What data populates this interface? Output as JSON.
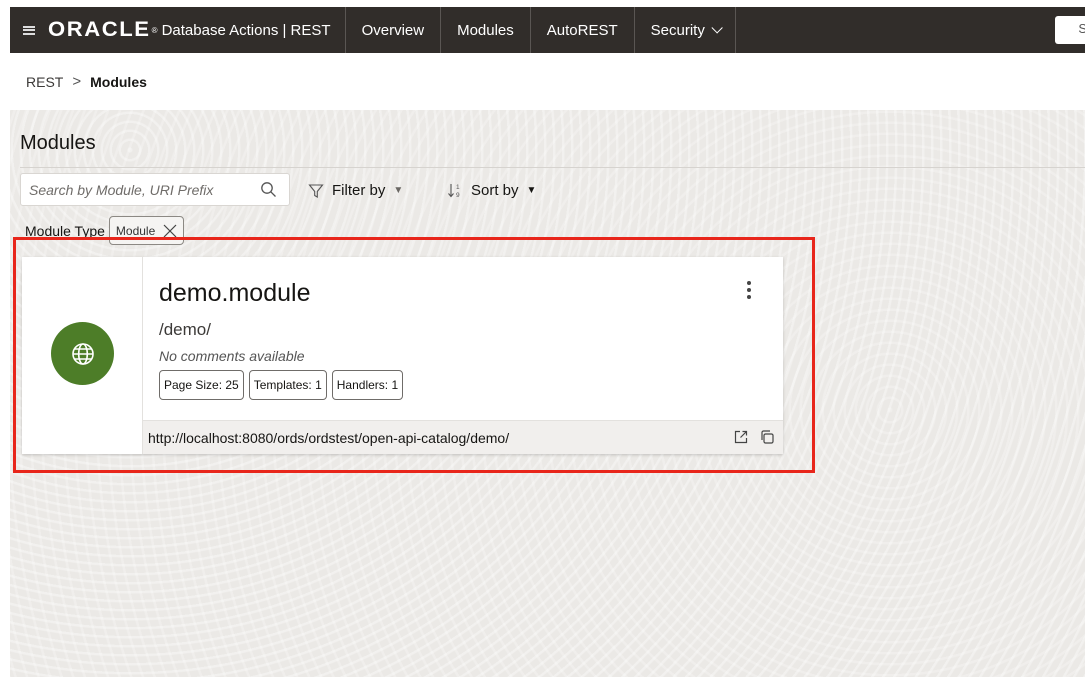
{
  "topbar": {
    "brand_logo": "ORACLE",
    "brand_mark": "®",
    "app_name": "Database Actions | REST",
    "tabs": [
      {
        "label": "Overview"
      },
      {
        "label": "Modules"
      },
      {
        "label": "AutoREST"
      },
      {
        "label": "Security"
      }
    ],
    "search_glyph": "S"
  },
  "breadcrumb": {
    "root": "REST",
    "separator": ">",
    "current": "Modules"
  },
  "main": {
    "title": "Modules",
    "search": {
      "placeholder": "Search by Module, URI Prefix",
      "value": ""
    },
    "filter_label": "Filter by",
    "sort_label": "Sort by",
    "module_type_label": "Module Type",
    "chip_label": "Module"
  },
  "card": {
    "name": "demo.module",
    "uri_prefix": "/demo/",
    "comment": "No comments available",
    "badges": [
      {
        "label": "Page Size: 25"
      },
      {
        "label": "Templates: 1"
      },
      {
        "label": "Handlers: 1"
      }
    ],
    "url": "http://localhost:8080/ords/ordstest/open-api-catalog/demo/",
    "icon": "globe-icon",
    "icon_bg": "#4d7d28"
  },
  "colors": {
    "topbar_bg": "#312d2a",
    "highlight": "#e8261b",
    "panel_bg": "#ebe9e6"
  }
}
